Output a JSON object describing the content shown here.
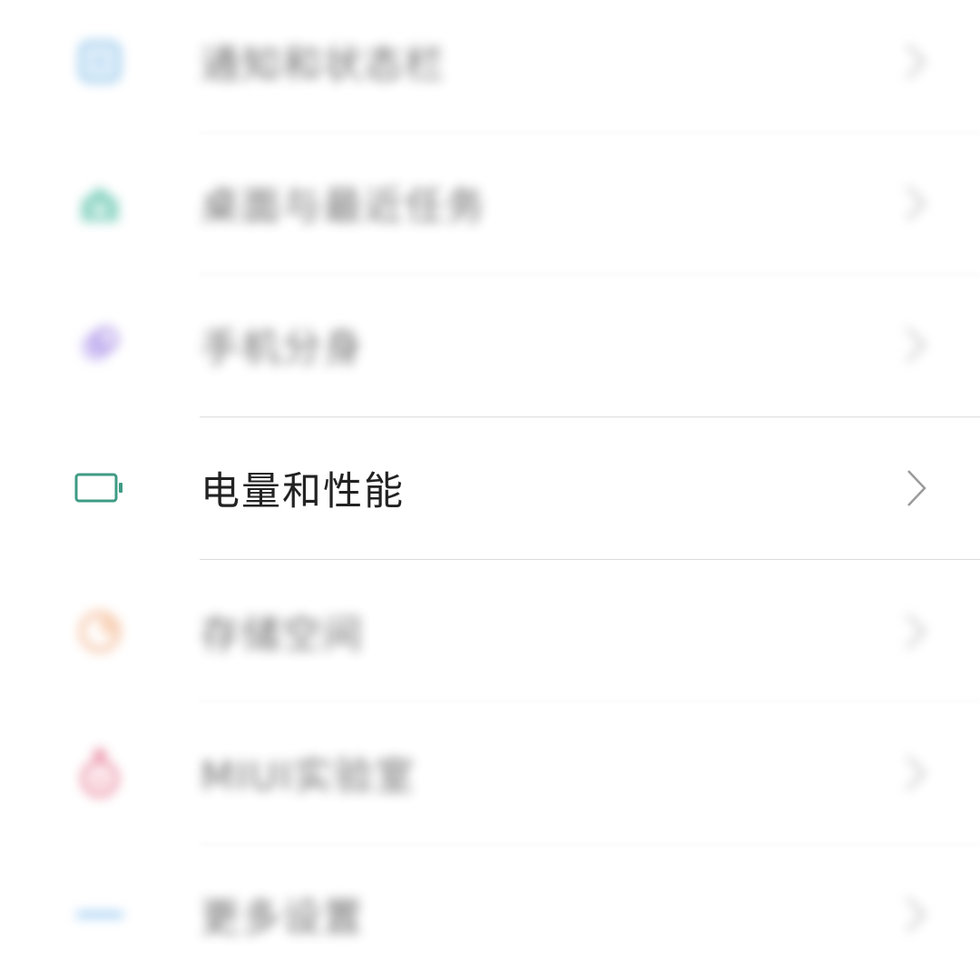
{
  "settings_items": [
    {
      "label": "通知和状态栏",
      "icon": "notification-icon",
      "color": "#5aa7e0"
    },
    {
      "label": "桌面与最近任务",
      "icon": "home-icon",
      "color": "#3cb79a"
    },
    {
      "label": "手机分身",
      "icon": "second-space-icon",
      "color": "#9a7be0"
    },
    {
      "label": "电量和性能",
      "icon": "battery-icon",
      "color": "#3f9b84"
    },
    {
      "label": "存储空间",
      "icon": "storage-icon",
      "color": "#f0a070"
    },
    {
      "label": "MIUI实验室",
      "icon": "lab-flask-icon",
      "color": "#e05a7a"
    },
    {
      "label": "更多设置",
      "icon": "more-icon",
      "color": "#6ab0ea"
    }
  ],
  "colors": {
    "chevron": "#9a9a9a",
    "divider": "#dcdcdc",
    "text": "#222222"
  }
}
